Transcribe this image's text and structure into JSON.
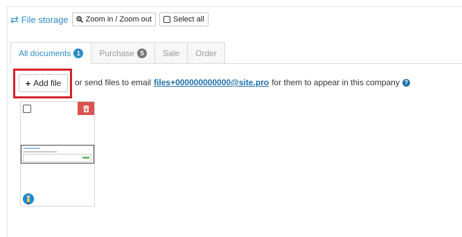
{
  "toolbar": {
    "title": "File storage",
    "zoom_label": "Zoom in / Zoom out",
    "select_all_label": "Select all"
  },
  "tabs": [
    {
      "label": "All documents",
      "count": "1",
      "active": true
    },
    {
      "label": "Purchase",
      "count": "5",
      "active": false
    },
    {
      "label": "Sale",
      "count": "",
      "active": false
    },
    {
      "label": "Order",
      "count": "",
      "active": false
    }
  ],
  "upload": {
    "add_file_label": "Add file",
    "text_before": "or send files to email",
    "email": "files+000000000000@site.pro",
    "text_after": "for them to appear in this company"
  },
  "colors": {
    "accent": "#2a8cc7",
    "highlight": "#d32027",
    "delete": "#d9534f"
  },
  "icons": {
    "title": "swap-arrows-icon",
    "zoom": "magnifier-icon",
    "add": "plus-icon",
    "help": "question-circle-icon",
    "delete": "trash-icon"
  }
}
